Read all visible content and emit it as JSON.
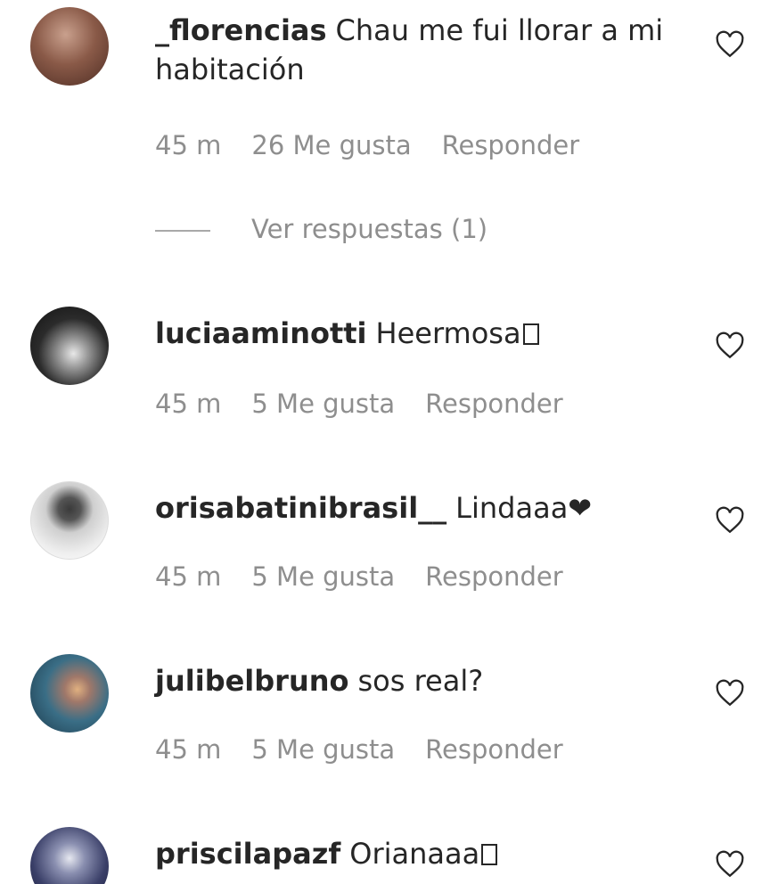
{
  "comments": [
    {
      "username": "_florencias",
      "text": "Chau me fui llorar a mi habitación",
      "time": "45 m",
      "likes": "26 Me gusta",
      "reply": "Responder",
      "replies_label": "Ver respuestas (1)"
    },
    {
      "username": "luciaaminotti",
      "text": "Heermosa",
      "time": "45 m",
      "likes": "5 Me gusta",
      "reply": "Responder"
    },
    {
      "username": "orisabatinibrasil__",
      "text": "Lindaaa❤",
      "time": "45 m",
      "likes": "5 Me gusta",
      "reply": "Responder"
    },
    {
      "username": "julibelbruno",
      "text": "sos real?",
      "time": "45 m",
      "likes": "5 Me gusta",
      "reply": "Responder"
    },
    {
      "username": "priscilapazf",
      "text": "Orianaaa",
      "time": "",
      "likes": "",
      "reply": ""
    }
  ],
  "icons": {
    "like": "heart-outline-icon"
  },
  "colors": {
    "meta": "#8e8e8e",
    "text": "#262626"
  }
}
